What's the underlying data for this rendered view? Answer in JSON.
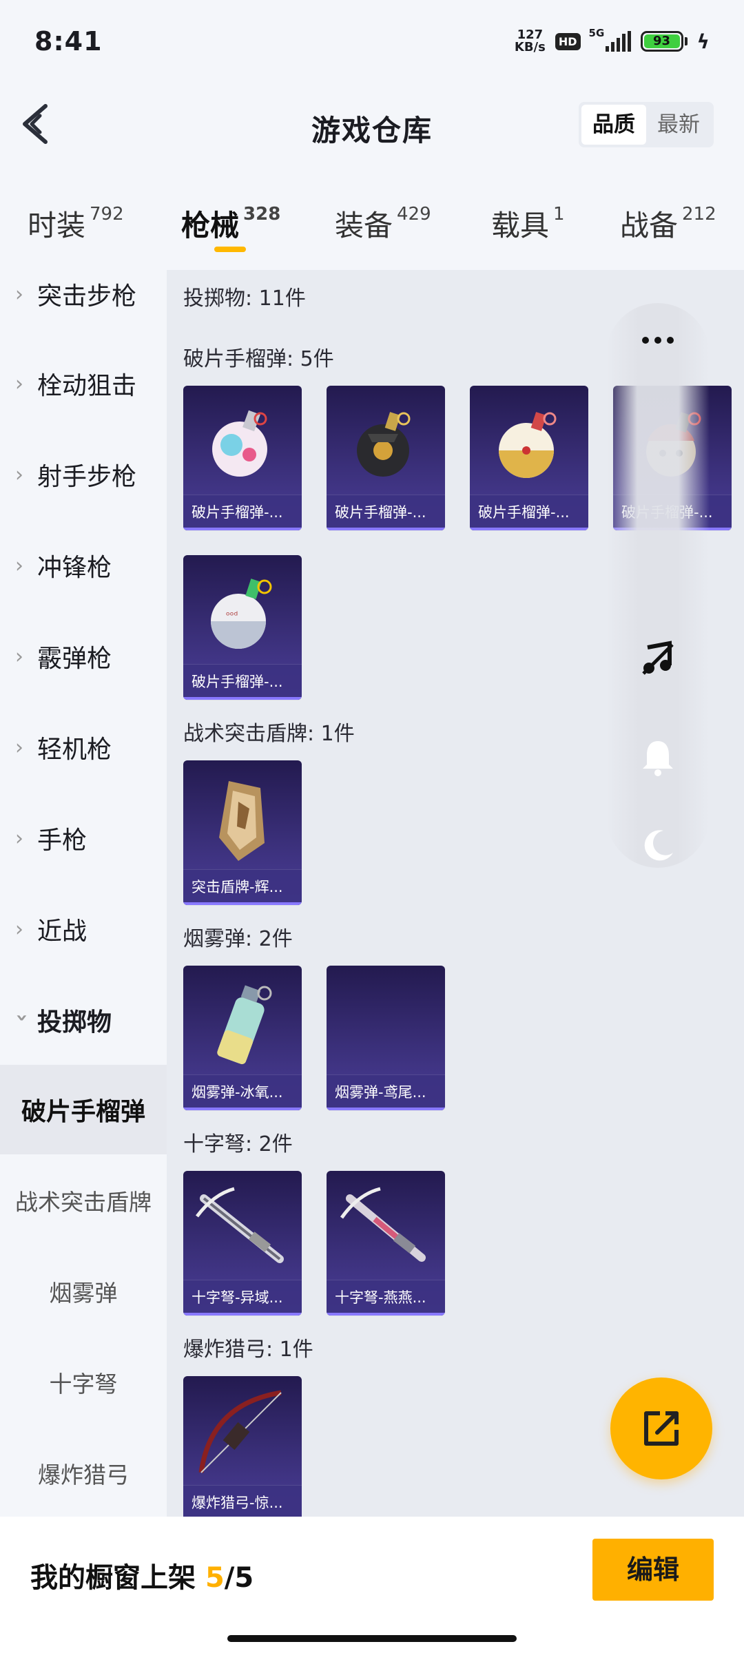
{
  "status_bar": {
    "time": "8:41",
    "net_speed_value": "127",
    "net_speed_unit": "KB/s",
    "hd": "HD",
    "network": "5G",
    "battery": "93"
  },
  "header": {
    "title": "游戏仓库",
    "sort_options": [
      "品质",
      "最新"
    ],
    "sort_selected": "品质"
  },
  "category_tabs": [
    {
      "label": "时装",
      "count": "792"
    },
    {
      "label": "枪械",
      "count": "328",
      "active": true
    },
    {
      "label": "装备",
      "count": "429"
    },
    {
      "label": "载具",
      "count": "1"
    },
    {
      "label": "战备",
      "count": "212"
    }
  ],
  "sidebar": {
    "groups": [
      "突击步枪",
      "栓动狙击",
      "射手步枪",
      "冲锋枪",
      "霰弹枪",
      "轻机枪",
      "手枪",
      "近战"
    ],
    "expanded_group": "投掷物",
    "sub_items": [
      "破片手榴弹",
      "战术突击盾牌",
      "烟雾弹",
      "十字弩",
      "爆炸猎弓"
    ],
    "selected_sub_item": "破片手榴弹"
  },
  "content": {
    "summary": "投掷物: 11件",
    "sections": [
      {
        "title": "破片手榴弹: 5件",
        "items": [
          "破片手榴弹-...",
          "破片手榴弹-...",
          "破片手榴弹-...",
          "破片手榴弹-...",
          "破片手榴弹-..."
        ]
      },
      {
        "title": "战术突击盾牌: 1件",
        "items": [
          "突击盾牌-辉..."
        ]
      },
      {
        "title": "烟雾弹: 2件",
        "items": [
          "烟雾弹-冰氧...",
          "烟雾弹-鸢尾..."
        ]
      },
      {
        "title": "十字弩: 2件",
        "items": [
          "十字弩-异域...",
          "十字弩-燕燕..."
        ]
      },
      {
        "title": "爆炸猎弓: 1件",
        "items": [
          "爆炸猎弓-惊..."
        ]
      }
    ]
  },
  "floating_panel": {
    "icons": [
      "more-icon",
      "music-off-icon",
      "bell-icon",
      "moon-icon"
    ]
  },
  "bottom_bar": {
    "label": "我的橱窗上架",
    "current": "5",
    "total": "/5",
    "edit_label": "编辑"
  },
  "colors": {
    "accent": "#ffb000",
    "card_dark": "#231a4f",
    "card_light": "#4b3e98",
    "card_stripe": "#8878ff"
  }
}
